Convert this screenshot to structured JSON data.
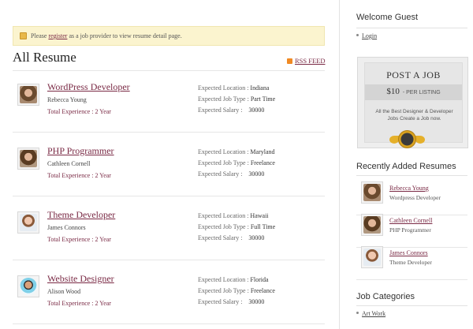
{
  "notice": {
    "prefix": "Please ",
    "link": "register",
    "suffix": " as a job provider to view resume detail page."
  },
  "page_title": "All Resume",
  "rss_label": "RSS FEED",
  "resumes": [
    {
      "title": "WordPress Developer",
      "name": "Rebecca Young",
      "experience": "Total Experience : 2 Year",
      "location_label": "Expected Location :",
      "location": "Indiana",
      "jobtype_label": "Expected Job Type :",
      "jobtype": "Part Time",
      "salary_label": "Expected Salary :",
      "salary": "30000"
    },
    {
      "title": "PHP Programmer",
      "name": "Cathleen Cornell",
      "experience": "Total Experience : 2 Year",
      "location_label": "Expected Location :",
      "location": "Maryland",
      "jobtype_label": "Expected Job Type :",
      "jobtype": "Freelance",
      "salary_label": "Expected Salary :",
      "salary": "30000"
    },
    {
      "title": "Theme Developer",
      "name": "James Connors",
      "experience": "Total Experience : 2 Year",
      "location_label": "Expected Location :",
      "location": "Hawaii",
      "jobtype_label": "Expected Job Type :",
      "jobtype": "Full Time",
      "salary_label": "Expected Salary :",
      "salary": "30000"
    },
    {
      "title": "Website Designer",
      "name": "Alison Wood",
      "experience": "Total Experience : 2 Year",
      "location_label": "Expected Location :",
      "location": "Florida",
      "jobtype_label": "Expected Job Type :",
      "jobtype": "Freelance",
      "salary_label": "Expected Salary :",
      "salary": "30000"
    }
  ],
  "sidebar": {
    "welcome_heading": "Welcome Guest",
    "login_label": "Login",
    "post_job": {
      "title": "POST A JOB",
      "price": "$10",
      "per": "- PER LISTING",
      "text": "All the Best Designer & Developer Jobs Create a Job now.",
      "seal_icon": "gold-medal-badge"
    },
    "recent_heading": "Recently Added Resumes",
    "recent": [
      {
        "name": "Rebecca Young",
        "job": "Wordpress Developer"
      },
      {
        "name": "Cathleen Cornell",
        "job": "PHP Programmer"
      },
      {
        "name": "James Connors",
        "job": "Theme Developer"
      }
    ],
    "categories_heading": "Job Categories",
    "categories": [
      "Art Work"
    ]
  },
  "colors": {
    "accent": "#7a2a45",
    "notice_bg": "#fbf4cf",
    "rss": "#f08a24",
    "seal_gold": "#e5b02a"
  }
}
